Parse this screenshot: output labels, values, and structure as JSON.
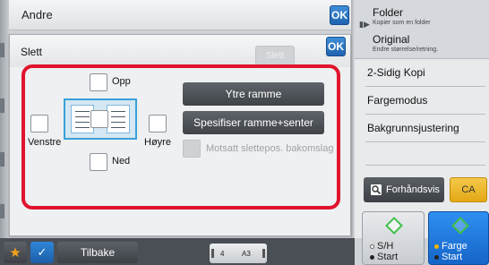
{
  "background_window": {
    "title": "Andre",
    "ok_label": "OK"
  },
  "dialog": {
    "title": "Slett",
    "ok_label": "OK",
    "slett_button_label": "Slett",
    "positions": {
      "top_label": "Opp",
      "left_label": "Venstre",
      "right_label": "Høyre",
      "bottom_label": "Ned"
    },
    "outer_frame_label": "Ytre ramme",
    "frame_center_label": "Spesifiser ramme+senter",
    "opposite_label": "Motsatt slettepos. bakomslag"
  },
  "right_panel": {
    "folder": {
      "title": "Folder",
      "subtitle": "Kopier som en folder"
    },
    "original": {
      "title": "Original",
      "subtitle": "Endre størrelse/retning."
    },
    "buttons": [
      "2-Sidig Kopi",
      "Fargemodus",
      "Bakgrunnsjustering"
    ]
  },
  "preview_label": "Forhåndsvis",
  "ca_label": "CA",
  "start_bw": {
    "line1": "S/H",
    "line2": "Start"
  },
  "start_color": {
    "line1": "Farge",
    "line2": "Start"
  },
  "bottom_bar": {
    "back_label": "Tilbake",
    "copies": "4",
    "paper_size": "A3"
  },
  "colors": {
    "highlight_border": "#e0142d",
    "ok_blue": "#1f63b0",
    "start_blue": "#1565c8",
    "ca_yellow": "#e3a816",
    "star_orange": "#f4a21c"
  }
}
